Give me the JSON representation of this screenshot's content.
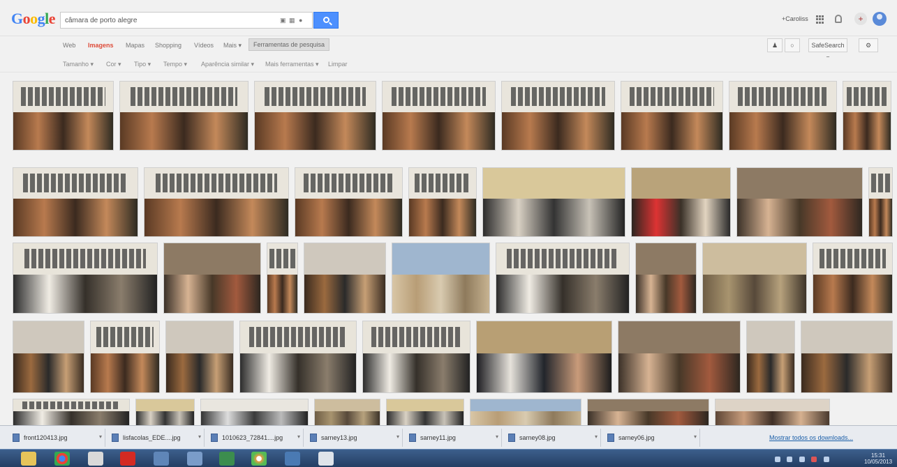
{
  "header": {
    "logo": "Google",
    "search_query": "câmara de porto alegre",
    "user_name": "+Caroliss"
  },
  "nav": {
    "items": [
      {
        "label": "Web"
      },
      {
        "label": "Imagens",
        "active": true
      },
      {
        "label": "Mapas"
      },
      {
        "label": "Shopping"
      },
      {
        "label": "Vídeos"
      },
      {
        "label": "Mais ▾"
      }
    ],
    "tools_label": "Ferramentas de pesquisa",
    "safesearch_label": "SafeSearch ▾"
  },
  "filters": [
    "Tamanho ▾",
    "Cor ▾",
    "Tipo ▾",
    "Tempo ▾",
    "Aparência similar ▾",
    "Mais ferramentas ▾",
    "Limpar"
  ],
  "image_rows": [
    [
      "office",
      "office",
      "office",
      "office",
      "office",
      "office",
      "office",
      "office"
    ],
    [
      "office",
      "office",
      "office",
      "office",
      "banner",
      "gallery",
      "crowd",
      "office"
    ],
    [
      "group",
      "crowd",
      "office",
      "meeting",
      "building",
      "group",
      "crowd",
      "street"
    ],
    [
      "meeting",
      "office",
      "meeting",
      "group",
      "group",
      "speaker",
      "crowd",
      "meeting",
      "meeting"
    ],
    [
      "group",
      "banner",
      "sign",
      "street",
      "banner",
      "building",
      "crowd",
      "portraits"
    ]
  ],
  "downloads": {
    "items": [
      {
        "name": "front120413.jpg"
      },
      {
        "name": "lisfacolas_EDE....jpg"
      },
      {
        "name": "1010623_72841....jpg"
      },
      {
        "name": "sarney13.jpg"
      },
      {
        "name": "sarney11.jpg"
      },
      {
        "name": "sarney08.jpg"
      },
      {
        "name": "sarney06.jpg"
      }
    ],
    "show_all": "Mostrar todos os downloads..."
  },
  "taskbar": {
    "time": "15:31",
    "date": "10/05/2013"
  },
  "colors": {
    "accent": "#4d90fe",
    "active_tab": "#dd4b39",
    "taskbar": "#2a4670"
  }
}
